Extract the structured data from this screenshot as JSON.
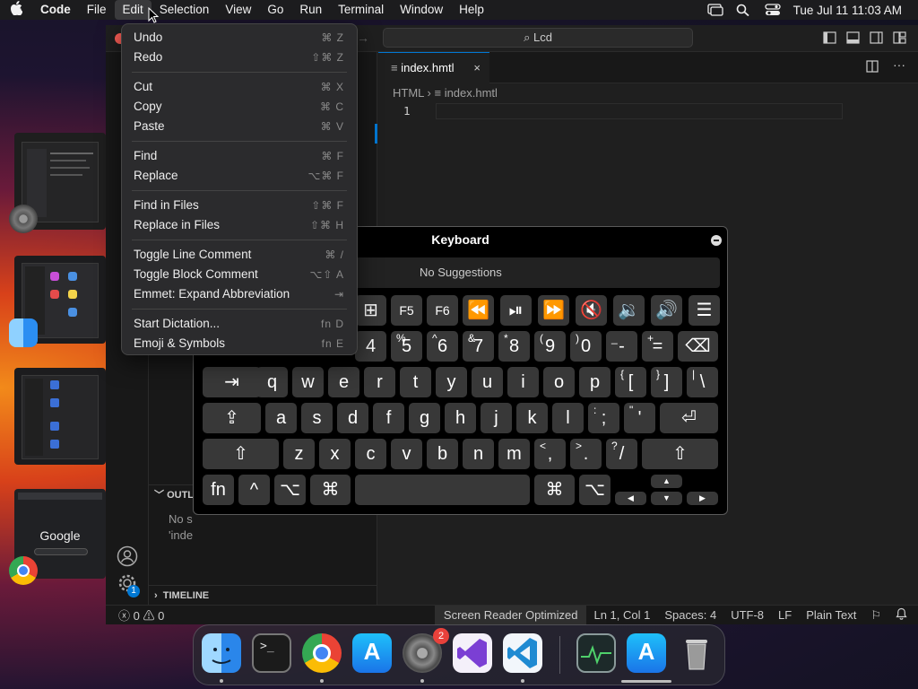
{
  "menubar": {
    "app": "Code",
    "items": [
      "File",
      "Edit",
      "Selection",
      "View",
      "Go",
      "Run",
      "Terminal",
      "Window",
      "Help"
    ],
    "datetime": "Tue Jul 11  11:03 AM"
  },
  "vscode": {
    "search": "Lcd",
    "tab": "index.hmtl",
    "breadcrumb_root": "HTML",
    "breadcrumb_file": "index.hmtl",
    "line_number": "1",
    "outline_label": "OUTLI",
    "outline_text1": "No s",
    "outline_text2": "'inde",
    "timeline_label": "TIMELINE",
    "status": {
      "errors": "0",
      "warnings": "0",
      "screen_reader": "Screen Reader Optimized",
      "position": "Ln 1, Col 1",
      "spaces": "Spaces: 4",
      "encoding": "UTF-8",
      "eol": "LF",
      "language": "Plain Text"
    },
    "accounts_badge": "1"
  },
  "edit_menu": {
    "items": [
      {
        "label": "Undo",
        "shortcut": "⌘ Z"
      },
      {
        "label": "Redo",
        "shortcut": "⇧⌘ Z"
      },
      {
        "label": "Cut",
        "shortcut": "⌘ X"
      },
      {
        "label": "Copy",
        "shortcut": "⌘ C"
      },
      {
        "label": "Paste",
        "shortcut": "⌘ V"
      },
      {
        "label": "Find",
        "shortcut": "⌘ F"
      },
      {
        "label": "Replace",
        "shortcut": "⌥⌘ F"
      },
      {
        "label": "Find in Files",
        "shortcut": "⇧⌘ F"
      },
      {
        "label": "Replace in Files",
        "shortcut": "⇧⌘ H"
      },
      {
        "label": "Toggle Line Comment",
        "shortcut": "⌘ /"
      },
      {
        "label": "Toggle Block Comment",
        "shortcut": "⌥⇧ A"
      },
      {
        "label": "Emmet: Expand Abbreviation",
        "shortcut": "⇥"
      },
      {
        "label": "Start Dictation...",
        "shortcut": "fn D"
      },
      {
        "label": "Emoji & Symbols",
        "shortcut": "fn E"
      }
    ]
  },
  "keyboard": {
    "title": "Keyboard",
    "suggestions": "No Suggestions",
    "fkeys": [
      "F5",
      "F6"
    ],
    "number_row": [
      {
        "main": "4",
        "shift": ""
      },
      {
        "main": "5",
        "shift": "%"
      },
      {
        "main": "6",
        "shift": "^"
      },
      {
        "main": "7",
        "shift": "&"
      },
      {
        "main": "8",
        "shift": "*"
      },
      {
        "main": "9",
        "shift": "("
      },
      {
        "main": "0",
        "shift": ")"
      },
      {
        "main": "-",
        "shift": "_"
      },
      {
        "main": "=",
        "shift": "+"
      }
    ],
    "row_q": [
      "q",
      "w",
      "e",
      "r",
      "t",
      "y",
      "u",
      "i",
      "o",
      "p"
    ],
    "row_q_extra": [
      {
        "main": "[",
        "shift": "{"
      },
      {
        "main": "]",
        "shift": "}"
      },
      {
        "main": "\\",
        "shift": "|"
      }
    ],
    "row_a": [
      "a",
      "s",
      "d",
      "f",
      "g",
      "h",
      "j",
      "k",
      "l"
    ],
    "row_a_extra": [
      {
        "main": ";",
        "shift": ":"
      },
      {
        "main": "'",
        "shift": "\""
      }
    ],
    "row_z": [
      "z",
      "x",
      "c",
      "v",
      "b",
      "n",
      "m"
    ],
    "row_z_extra": [
      {
        "main": ",",
        "shift": "<"
      },
      {
        "main": ".",
        "shift": ">"
      },
      {
        "main": "/",
        "shift": "?"
      }
    ],
    "bottom": {
      "fn": "fn",
      "ctrl": "^",
      "opt": "⌥",
      "cmd": "⌘"
    }
  },
  "dock": {
    "apps": [
      "finder-icon",
      "terminal-icon",
      "chrome-icon",
      "app-store-icon",
      "system-settings-icon",
      "visual-studio-icon",
      "vscode-icon",
      "activity-monitor-icon",
      "app-store-icon",
      "trash-icon"
    ],
    "settings_badge": "2"
  },
  "stage_manager": {
    "google_text": "Google"
  }
}
